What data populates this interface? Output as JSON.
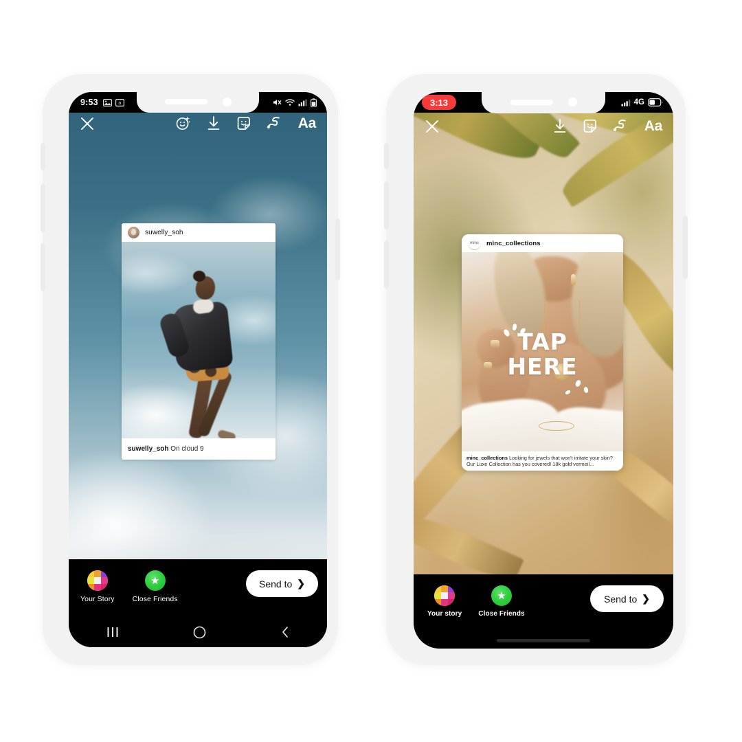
{
  "page": {
    "title": "Instagram Story share screen mockups",
    "background_color": "#ffffff"
  },
  "colors": {
    "accent_red": "#f73b3b",
    "close_friends_green": "#1fb82f",
    "black": "#000000",
    "white": "#ffffff"
  },
  "phones": [
    {
      "id": "phone-left",
      "platform": "android",
      "status_bar": {
        "time": "9:53",
        "left_icons": [
          "photo-icon",
          "screenshot-icon"
        ],
        "right_icons": [
          "mute-icon",
          "wifi-icon",
          "signal-icon",
          "battery-icon"
        ],
        "network_label": ""
      },
      "toolbar": {
        "close_label": "✕",
        "icons": [
          "effects-face-icon",
          "download-icon",
          "sticker-icon",
          "draw-squiggle-icon",
          "text-aa-icon"
        ],
        "text_icon_label": "Aa"
      },
      "story_card": {
        "username": "suwelly_soh",
        "avatar": "profile-photo-avatar",
        "caption_user": "suwelly_soh",
        "caption_text": "On cloud 9",
        "overlay_text": ""
      },
      "share_bar": {
        "your_story_label": "Your Story",
        "close_friends_label": "Close Friends",
        "send_to_label": "Send to",
        "send_to_chevron": "❯"
      },
      "nav_bar": {
        "type": "android-three-button",
        "recents": "|||",
        "home": "○",
        "back": "‹"
      }
    },
    {
      "id": "phone-right",
      "platform": "ios",
      "status_bar": {
        "time": "3:13",
        "time_is_recording_pill": true,
        "left_icons": [],
        "right_icons": [
          "signal-icon",
          "battery-icon"
        ],
        "network_label": "4G"
      },
      "toolbar": {
        "close_label": "✕",
        "icons": [
          "download-icon",
          "sticker-icon",
          "draw-squiggle-icon",
          "text-aa-icon"
        ],
        "text_icon_label": "Aa"
      },
      "story_card": {
        "username": "minc_collections",
        "avatar": "minc-logo-avatar",
        "avatar_logo_text": "minc",
        "caption_user": "minc_collections",
        "caption_text": "Looking for jewels that won't irritate your skin? Our Luxe Collection has you covered! 18k gold vermeil...",
        "overlay_text_line1": "TAP",
        "overlay_text_line2": "HERE"
      },
      "share_bar": {
        "your_story_label": "Your story",
        "close_friends_label": "Close Friends",
        "send_to_label": "Send to",
        "send_to_chevron": "❯"
      },
      "nav_bar": {
        "type": "ios-home-indicator",
        "recents": "",
        "home": "",
        "back": ""
      }
    }
  ]
}
